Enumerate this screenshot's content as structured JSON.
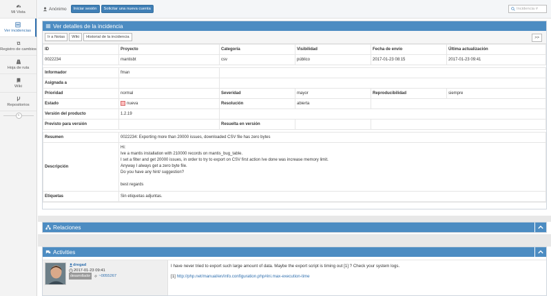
{
  "sidebar": {
    "items": [
      {
        "label": "Mi Vista",
        "icon": "dashboard-icon"
      },
      {
        "label": "Ver incidencias",
        "icon": "list-icon"
      },
      {
        "label": "Registro de cambios",
        "icon": "retweet-icon"
      },
      {
        "label": "Hoja de ruta",
        "icon": "road-icon"
      },
      {
        "label": "Wiki",
        "icon": "book-icon"
      },
      {
        "label": "Repositorios",
        "icon": "code-fork-icon"
      }
    ]
  },
  "topbar": {
    "user": "Anónimo",
    "login_button": "Iniciar sesión",
    "signup_button": "Solicitar una nueva cuenta",
    "search_placeholder": "Incidencia #"
  },
  "details": {
    "title": "Ver detalles de la incidencia",
    "toolbar": {
      "notes": "Ir a Notas",
      "wiki": "Wiki",
      "history": "Historial de la incidencia",
      "next": ">>"
    },
    "headers": {
      "id": "ID",
      "project": "Proyecto",
      "category": "Categoría",
      "visibility": "Visibilidad",
      "submitted": "Fecha de envío",
      "updated": "Última actualización"
    },
    "values": {
      "id": "0022234",
      "project": "mantisbt",
      "category": "csv",
      "visibility": "público",
      "submitted": "2017-01-23 08:15",
      "updated": "2017-01-23 09:41"
    },
    "reporter_label": "Informador",
    "reporter": "fman",
    "assigned_label": "Asignada a",
    "assigned": "",
    "priority_label": "Prioridad",
    "priority": "normal",
    "severity_label": "Severidad",
    "severity": "mayor",
    "reproducibility_label": "Reproducibilidad",
    "reproducibility": "siempre",
    "status_label": "Estado",
    "status": "nueva",
    "status_color": "#fcbdbd",
    "resolution_label": "Resolución",
    "resolution": "abierta",
    "product_version_label": "Versión del producto",
    "product_version": "1.2.19",
    "target_version_label": "Previsto para versión",
    "target_version": "",
    "fixed_version_label": "Resuelta en versión",
    "fixed_version": "",
    "summary_label": "Resumen",
    "summary": "0022234: Exporting more than 20000 issues, downloaded CSV file has zero bytes",
    "description_label": "Descripción",
    "description_lines": [
      "Hi:",
      "Ive a mantis installation with 210000 records on mantis_bug_table.",
      "I set a filter and get 20000 issues, in order to try to export on CSV first action Ive done was increase memory limit.",
      "Anyway I always get a zero byte file.",
      "Do you have any hint/ suggestion?",
      "",
      "best regards"
    ],
    "tags_label": "Etiquetas",
    "tags": "Sin etiquetas adjuntas."
  },
  "relations": {
    "title": "Relaciones"
  },
  "activities": {
    "title": "Activities",
    "items": [
      {
        "author": "dregad",
        "timestamp": "2017-01-23 09:41",
        "role": "desarrollador",
        "note_id": "~0055267",
        "text": "I have never tried to export such large amount of data. Maybe the export script is timing out [1] ? Check your system logs.",
        "ref_prefix": "[1] ",
        "ref_link": "http://php.net/manual/en/info.configuration.php#ini.max-execution-time"
      }
    ]
  },
  "colors": {
    "accent": "#4c8cc2",
    "button": "#3f7fb6",
    "link": "#2f6fae"
  }
}
